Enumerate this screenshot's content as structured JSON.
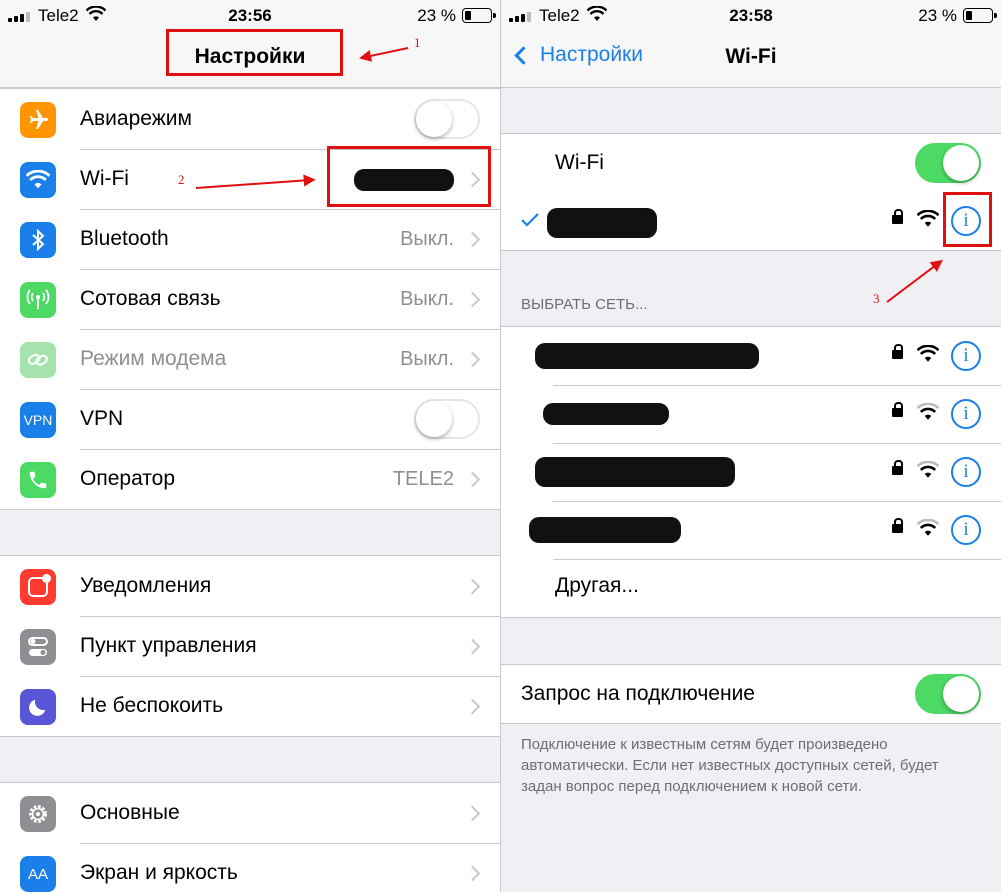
{
  "left": {
    "status": {
      "carrier": "Tele2",
      "time": "23:56",
      "battery": "23 %"
    },
    "title": "Настройки",
    "group1": [
      {
        "label": "Авиарежим",
        "icon": "airplane-icon",
        "color": "#ff9500",
        "toggle": false
      },
      {
        "label": "Wi-Fi",
        "icon": "wifi-icon",
        "color": "#1a7fe8"
      },
      {
        "label": "Bluetooth",
        "icon": "bluetooth-icon",
        "color": "#1a7fe8",
        "value": "Выкл."
      },
      {
        "label": "Сотовая связь",
        "icon": "antenna-icon",
        "color": "#4cd964",
        "value": "Выкл."
      },
      {
        "label": "Режим модема",
        "icon": "chain-link-icon",
        "color": "#a6e3ac",
        "value": "Выкл."
      },
      {
        "label": "VPN",
        "icon": "vpn-icon",
        "icon_text": "VPN",
        "color": "#1a7fe8",
        "toggle": false
      },
      {
        "label": "Оператор",
        "icon": "phone-icon",
        "color": "#4cd964",
        "value": "TELE2"
      }
    ],
    "group2": [
      {
        "label": "Уведомления",
        "icon": "notifications-icon",
        "color": "#ff3b30"
      },
      {
        "label": "Пункт управления",
        "icon": "switches-icon",
        "color": "#8e8e93"
      },
      {
        "label": "Не беспокоить",
        "icon": "moon-icon",
        "color": "#5856d6"
      }
    ],
    "group3": [
      {
        "label": "Основные",
        "icon": "gear-icon",
        "color": "#8e8e93"
      },
      {
        "label": "Экран и яркость",
        "icon": "text-size-icon",
        "icon_text": "AA",
        "color": "#1a7fe8"
      }
    ],
    "annotations": [
      "1",
      "2"
    ]
  },
  "right": {
    "status": {
      "carrier": "Tele2",
      "time": "23:58",
      "battery": "23 %"
    },
    "back_label": "Настройки",
    "title": "Wi-Fi",
    "wifi_label": "Wi-Fi",
    "wifi_on": true,
    "choose_network": "ВЫБРАТЬ СЕТЬ...",
    "other_network": "Другая...",
    "ask_to_join": "Запрос на подключение",
    "ask_to_join_on": true,
    "footer": "Подключение к известным сетям будет произведено автоматически. Если нет известных доступных сетей, будет задан вопрос перед подключением к новой сети.",
    "info_glyph": "i",
    "annotations": [
      "3"
    ]
  },
  "colors": {
    "accent": "#1a7fe8",
    "annotation": "#e01010",
    "switch_on": "#4cd964"
  }
}
